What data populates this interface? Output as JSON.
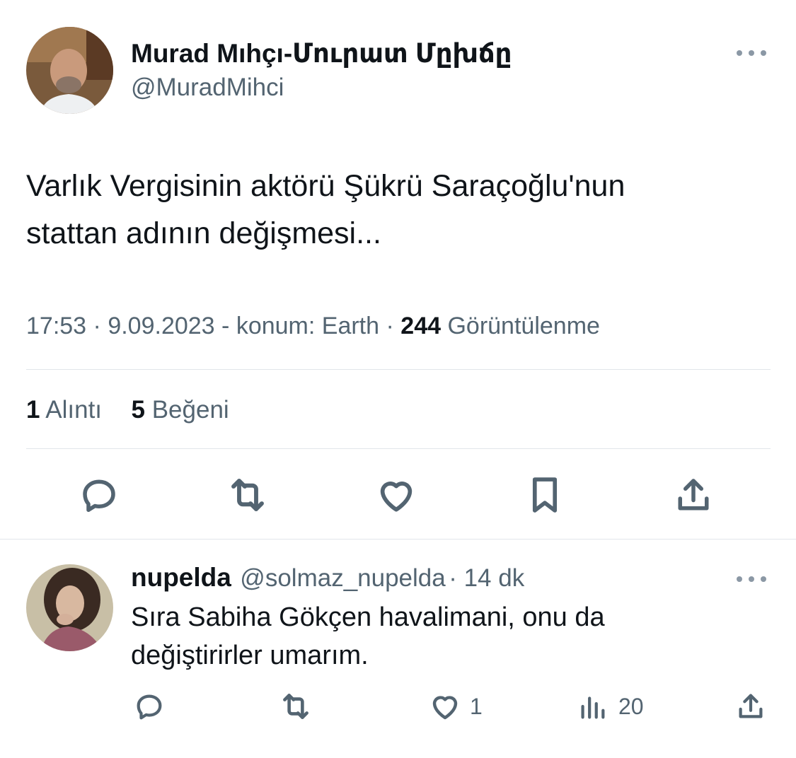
{
  "main_tweet": {
    "display_name": "Murad Mıhçı-Մուրատ Մըխճը",
    "handle": "@MuradMihci",
    "text_line1": "Varlık Vergisinin aktörü Şükrü Saraçoğlu'nun",
    "text_line2": "stattan adının değişmesi...",
    "time": "17:53",
    "date": "9.09.2023",
    "location": "konum: Earth",
    "views_count": "244",
    "views_label": "Görüntülenme",
    "quotes_count": "1",
    "quotes_label": "Alıntı",
    "likes_count": "5",
    "likes_label": "Beğeni",
    "more_icon": "more-horizontal-icon"
  },
  "actions": [
    "reply-icon",
    "retweet-icon",
    "like-icon",
    "bookmark-icon",
    "share-icon"
  ],
  "reply": {
    "display_name": "nupelda",
    "handle": "@solmaz_nupelda",
    "age": "14 dk",
    "text_line1": "Sıra Sabiha Gökçen havalimani, onu da",
    "text_line2": "değiştirirler umarım.",
    "likes": "1",
    "views": "20"
  },
  "colors": {
    "text": "#0f1419",
    "secondary": "#536471",
    "divider": "#e1e6ea"
  }
}
